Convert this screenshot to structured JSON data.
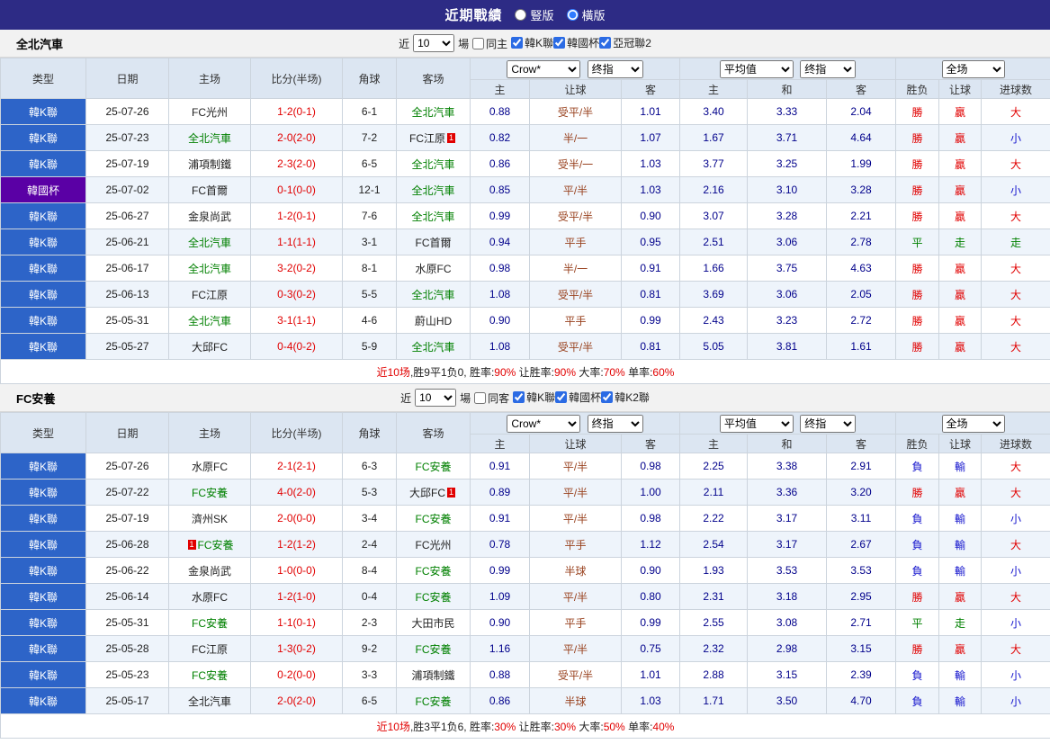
{
  "titlebar": {
    "title": "近期戰績",
    "radios": [
      {
        "label": "豎版",
        "selected": false
      },
      {
        "label": "橫版",
        "selected": true
      }
    ]
  },
  "headers": {
    "type": "类型",
    "date": "日期",
    "home": "主场",
    "score": "比分(半场)",
    "corner": "角球",
    "away": "客场",
    "asia_home": "主",
    "handicap": "让球",
    "asia_away": "客",
    "eu_home": "主",
    "eu_draw": "和",
    "eu_away": "客",
    "result": "胜负",
    "handicap_result": "让球",
    "goals": "进球数"
  },
  "colors": {
    "win": "#e10000",
    "lose": "#1414cd",
    "draw": "#008000",
    "league_blue": "#2d64c8",
    "league_purple": "#5a00a5",
    "focus_team": "#008000",
    "score_red": "#e10000",
    "odds_navy": "#00008b",
    "handicap_brown": "#99421f"
  },
  "sections": [
    {
      "team": "全北汽車",
      "controls": {
        "near": "近",
        "count": "10",
        "games": "場",
        "same": {
          "label": "同主",
          "checked": false
        },
        "leagues": [
          {
            "label": "韓K聯",
            "checked": true
          },
          {
            "label": "韓國杯",
            "checked": true
          },
          {
            "label": "亞冠聯2",
            "checked": true
          }
        ]
      },
      "selects": {
        "asia": [
          "Crow*",
          "终指"
        ],
        "europe": [
          "平均值",
          "终指"
        ],
        "scope": [
          "全场"
        ]
      },
      "rows": [
        {
          "league": "韓K聯",
          "lg": "blue",
          "date": "25-07-26",
          "home": "FC光州",
          "home_focus": false,
          "home_badge": "",
          "score": "1-2(0-1)",
          "corner": "6-1",
          "away": "全北汽車",
          "away_focus": true,
          "away_badge": "",
          "ah": "0.88",
          "hc": "受平/半",
          "aa": "1.01",
          "eh": "3.40",
          "ed": "3.33",
          "ea": "2.04",
          "res": "勝",
          "res_c": "win",
          "hr": "贏",
          "hr_c": "win",
          "gl": "大",
          "gl_c": "win"
        },
        {
          "league": "韓K聯",
          "lg": "blue",
          "date": "25-07-23",
          "home": "全北汽車",
          "home_focus": true,
          "home_badge": "",
          "score": "2-0(2-0)",
          "corner": "7-2",
          "away": "FC江原",
          "away_focus": false,
          "away_badge": "1",
          "ah": "0.82",
          "hc": "半/一",
          "aa": "1.07",
          "eh": "1.67",
          "ed": "3.71",
          "ea": "4.64",
          "res": "勝",
          "res_c": "win",
          "hr": "贏",
          "hr_c": "win",
          "gl": "小",
          "gl_c": "lose"
        },
        {
          "league": "韓K聯",
          "lg": "blue",
          "date": "25-07-19",
          "home": "浦項制鐵",
          "home_focus": false,
          "home_badge": "",
          "score": "2-3(2-0)",
          "corner": "6-5",
          "away": "全北汽車",
          "away_focus": true,
          "away_badge": "",
          "ah": "0.86",
          "hc": "受半/一",
          "aa": "1.03",
          "eh": "3.77",
          "ed": "3.25",
          "ea": "1.99",
          "res": "勝",
          "res_c": "win",
          "hr": "贏",
          "hr_c": "win",
          "gl": "大",
          "gl_c": "win"
        },
        {
          "league": "韓國杯",
          "lg": "purple",
          "date": "25-07-02",
          "home": "FC首爾",
          "home_focus": false,
          "home_badge": "",
          "score": "0-1(0-0)",
          "corner": "12-1",
          "away": "全北汽車",
          "away_focus": true,
          "away_badge": "",
          "ah": "0.85",
          "hc": "平/半",
          "aa": "1.03",
          "eh": "2.16",
          "ed": "3.10",
          "ea": "3.28",
          "res": "勝",
          "res_c": "win",
          "hr": "贏",
          "hr_c": "win",
          "gl": "小",
          "gl_c": "lose"
        },
        {
          "league": "韓K聯",
          "lg": "blue",
          "date": "25-06-27",
          "home": "金泉尚武",
          "home_focus": false,
          "home_badge": "",
          "score": "1-2(0-1)",
          "corner": "7-6",
          "away": "全北汽車",
          "away_focus": true,
          "away_badge": "",
          "ah": "0.99",
          "hc": "受平/半",
          "aa": "0.90",
          "eh": "3.07",
          "ed": "3.28",
          "ea": "2.21",
          "res": "勝",
          "res_c": "win",
          "hr": "贏",
          "hr_c": "win",
          "gl": "大",
          "gl_c": "win"
        },
        {
          "league": "韓K聯",
          "lg": "blue",
          "date": "25-06-21",
          "home": "全北汽車",
          "home_focus": true,
          "home_badge": "",
          "score": "1-1(1-1)",
          "corner": "3-1",
          "away": "FC首爾",
          "away_focus": false,
          "away_badge": "",
          "ah": "0.94",
          "hc": "平手",
          "aa": "0.95",
          "eh": "2.51",
          "ed": "3.06",
          "ea": "2.78",
          "res": "平",
          "res_c": "draw",
          "hr": "走",
          "hr_c": "draw",
          "gl": "走",
          "gl_c": "draw"
        },
        {
          "league": "韓K聯",
          "lg": "blue",
          "date": "25-06-17",
          "home": "全北汽車",
          "home_focus": true,
          "home_badge": "",
          "score": "3-2(0-2)",
          "corner": "8-1",
          "away": "水原FC",
          "away_focus": false,
          "away_badge": "",
          "ah": "0.98",
          "hc": "半/一",
          "aa": "0.91",
          "eh": "1.66",
          "ed": "3.75",
          "ea": "4.63",
          "res": "勝",
          "res_c": "win",
          "hr": "贏",
          "hr_c": "win",
          "gl": "大",
          "gl_c": "win"
        },
        {
          "league": "韓K聯",
          "lg": "blue",
          "date": "25-06-13",
          "home": "FC江原",
          "home_focus": false,
          "home_badge": "",
          "score": "0-3(0-2)",
          "corner": "5-5",
          "away": "全北汽車",
          "away_focus": true,
          "away_badge": "",
          "ah": "1.08",
          "hc": "受平/半",
          "aa": "0.81",
          "eh": "3.69",
          "ed": "3.06",
          "ea": "2.05",
          "res": "勝",
          "res_c": "win",
          "hr": "贏",
          "hr_c": "win",
          "gl": "大",
          "gl_c": "win"
        },
        {
          "league": "韓K聯",
          "lg": "blue",
          "date": "25-05-31",
          "home": "全北汽車",
          "home_focus": true,
          "home_badge": "",
          "score": "3-1(1-1)",
          "corner": "4-6",
          "away": "蔚山HD",
          "away_focus": false,
          "away_badge": "",
          "ah": "0.90",
          "hc": "平手",
          "aa": "0.99",
          "eh": "2.43",
          "ed": "3.23",
          "ea": "2.72",
          "res": "勝",
          "res_c": "win",
          "hr": "贏",
          "hr_c": "win",
          "gl": "大",
          "gl_c": "win"
        },
        {
          "league": "韓K聯",
          "lg": "blue",
          "date": "25-05-27",
          "home": "大邱FC",
          "home_focus": false,
          "home_badge": "",
          "score": "0-4(0-2)",
          "corner": "5-9",
          "away": "全北汽車",
          "away_focus": true,
          "away_badge": "",
          "ah": "1.08",
          "hc": "受平/半",
          "aa": "0.81",
          "eh": "5.05",
          "ed": "3.81",
          "ea": "1.61",
          "res": "勝",
          "res_c": "win",
          "hr": "贏",
          "hr_c": "win",
          "gl": "大",
          "gl_c": "win"
        }
      ],
      "summary": [
        {
          "text": "近10场",
          "red": true
        },
        {
          "text": ",胜9平1负0, 胜率:",
          "red": false
        },
        {
          "text": "90%",
          "red": true
        },
        {
          "text": " 让胜率:",
          "red": false
        },
        {
          "text": "90%",
          "red": true
        },
        {
          "text": " 大率:",
          "red": false
        },
        {
          "text": "70%",
          "red": true
        },
        {
          "text": " 单率:",
          "red": false
        },
        {
          "text": "60%",
          "red": true
        }
      ]
    },
    {
      "team": "FC安養",
      "controls": {
        "near": "近",
        "count": "10",
        "games": "場",
        "same": {
          "label": "同客",
          "checked": false
        },
        "leagues": [
          {
            "label": "韓K聯",
            "checked": true
          },
          {
            "label": "韓國杯",
            "checked": true
          },
          {
            "label": "韓K2聯",
            "checked": true
          }
        ]
      },
      "selects": {
        "asia": [
          "Crow*",
          "终指"
        ],
        "europe": [
          "平均值",
          "终指"
        ],
        "scope": [
          "全场"
        ]
      },
      "rows": [
        {
          "league": "韓K聯",
          "lg": "blue",
          "date": "25-07-26",
          "home": "水原FC",
          "home_focus": false,
          "home_badge": "",
          "score": "2-1(2-1)",
          "corner": "6-3",
          "away": "FC安養",
          "away_focus": true,
          "away_badge": "",
          "ah": "0.91",
          "hc": "平/半",
          "aa": "0.98",
          "eh": "2.25",
          "ed": "3.38",
          "ea": "2.91",
          "res": "負",
          "res_c": "lose",
          "hr": "輸",
          "hr_c": "lose",
          "gl": "大",
          "gl_c": "win"
        },
        {
          "league": "韓K聯",
          "lg": "blue",
          "date": "25-07-22",
          "home": "FC安養",
          "home_focus": true,
          "home_badge": "",
          "score": "4-0(2-0)",
          "corner": "5-3",
          "away": "大邱FC",
          "away_focus": false,
          "away_badge": "1",
          "ah": "0.89",
          "hc": "平/半",
          "aa": "1.00",
          "eh": "2.11",
          "ed": "3.36",
          "ea": "3.20",
          "res": "勝",
          "res_c": "win",
          "hr": "贏",
          "hr_c": "win",
          "gl": "大",
          "gl_c": "win"
        },
        {
          "league": "韓K聯",
          "lg": "blue",
          "date": "25-07-19",
          "home": "濟州SK",
          "home_focus": false,
          "home_badge": "",
          "score": "2-0(0-0)",
          "corner": "3-4",
          "away": "FC安養",
          "away_focus": true,
          "away_badge": "",
          "ah": "0.91",
          "hc": "平/半",
          "aa": "0.98",
          "eh": "2.22",
          "ed": "3.17",
          "ea": "3.11",
          "res": "負",
          "res_c": "lose",
          "hr": "輸",
          "hr_c": "lose",
          "gl": "小",
          "gl_c": "lose"
        },
        {
          "league": "韓K聯",
          "lg": "blue",
          "date": "25-06-28",
          "home": "FC安養",
          "home_focus": true,
          "home_badge": "1",
          "score": "1-2(1-2)",
          "corner": "2-4",
          "away": "FC光州",
          "away_focus": false,
          "away_badge": "",
          "ah": "0.78",
          "hc": "平手",
          "aa": "1.12",
          "eh": "2.54",
          "ed": "3.17",
          "ea": "2.67",
          "res": "負",
          "res_c": "lose",
          "hr": "輸",
          "hr_c": "lose",
          "gl": "大",
          "gl_c": "win"
        },
        {
          "league": "韓K聯",
          "lg": "blue",
          "date": "25-06-22",
          "home": "金泉尚武",
          "home_focus": false,
          "home_badge": "",
          "score": "1-0(0-0)",
          "corner": "8-4",
          "away": "FC安養",
          "away_focus": true,
          "away_badge": "",
          "ah": "0.99",
          "hc": "半球",
          "aa": "0.90",
          "eh": "1.93",
          "ed": "3.53",
          "ea": "3.53",
          "res": "負",
          "res_c": "lose",
          "hr": "輸",
          "hr_c": "lose",
          "gl": "小",
          "gl_c": "lose"
        },
        {
          "league": "韓K聯",
          "lg": "blue",
          "date": "25-06-14",
          "home": "水原FC",
          "home_focus": false,
          "home_badge": "",
          "score": "1-2(1-0)",
          "corner": "0-4",
          "away": "FC安養",
          "away_focus": true,
          "away_badge": "",
          "ah": "1.09",
          "hc": "平/半",
          "aa": "0.80",
          "eh": "2.31",
          "ed": "3.18",
          "ea": "2.95",
          "res": "勝",
          "res_c": "win",
          "hr": "贏",
          "hr_c": "win",
          "gl": "大",
          "gl_c": "win"
        },
        {
          "league": "韓K聯",
          "lg": "blue",
          "date": "25-05-31",
          "home": "FC安養",
          "home_focus": true,
          "home_badge": "",
          "score": "1-1(0-1)",
          "corner": "2-3",
          "away": "大田市民",
          "away_focus": false,
          "away_badge": "",
          "ah": "0.90",
          "hc": "平手",
          "aa": "0.99",
          "eh": "2.55",
          "ed": "3.08",
          "ea": "2.71",
          "res": "平",
          "res_c": "draw",
          "hr": "走",
          "hr_c": "draw",
          "gl": "小",
          "gl_c": "lose"
        },
        {
          "league": "韓K聯",
          "lg": "blue",
          "date": "25-05-28",
          "home": "FC江原",
          "home_focus": false,
          "home_badge": "",
          "score": "1-3(0-2)",
          "corner": "9-2",
          "away": "FC安養",
          "away_focus": true,
          "away_badge": "",
          "ah": "1.16",
          "hc": "平/半",
          "aa": "0.75",
          "eh": "2.32",
          "ed": "2.98",
          "ea": "3.15",
          "res": "勝",
          "res_c": "win",
          "hr": "贏",
          "hr_c": "win",
          "gl": "大",
          "gl_c": "win"
        },
        {
          "league": "韓K聯",
          "lg": "blue",
          "date": "25-05-23",
          "home": "FC安養",
          "home_focus": true,
          "home_badge": "",
          "score": "0-2(0-0)",
          "corner": "3-3",
          "away": "浦項制鐵",
          "away_focus": false,
          "away_badge": "",
          "ah": "0.88",
          "hc": "受平/半",
          "aa": "1.01",
          "eh": "2.88",
          "ed": "3.15",
          "ea": "2.39",
          "res": "負",
          "res_c": "lose",
          "hr": "輸",
          "hr_c": "lose",
          "gl": "小",
          "gl_c": "lose"
        },
        {
          "league": "韓K聯",
          "lg": "blue",
          "date": "25-05-17",
          "home": "全北汽車",
          "home_focus": false,
          "home_badge": "",
          "score": "2-0(2-0)",
          "corner": "6-5",
          "away": "FC安養",
          "away_focus": true,
          "away_badge": "",
          "ah": "0.86",
          "hc": "半球",
          "aa": "1.03",
          "eh": "1.71",
          "ed": "3.50",
          "ea": "4.70",
          "res": "負",
          "res_c": "lose",
          "hr": "輸",
          "hr_c": "lose",
          "gl": "小",
          "gl_c": "lose"
        }
      ],
      "summary": [
        {
          "text": "近10场",
          "red": true
        },
        {
          "text": ",胜3平1负6, 胜率:",
          "red": false
        },
        {
          "text": "30%",
          "red": true
        },
        {
          "text": " 让胜率:",
          "red": false
        },
        {
          "text": "30%",
          "red": true
        },
        {
          "text": " 大率:",
          "red": false
        },
        {
          "text": "50%",
          "red": true
        },
        {
          "text": " 单率:",
          "red": false
        },
        {
          "text": "40%",
          "red": true
        }
      ]
    }
  ]
}
